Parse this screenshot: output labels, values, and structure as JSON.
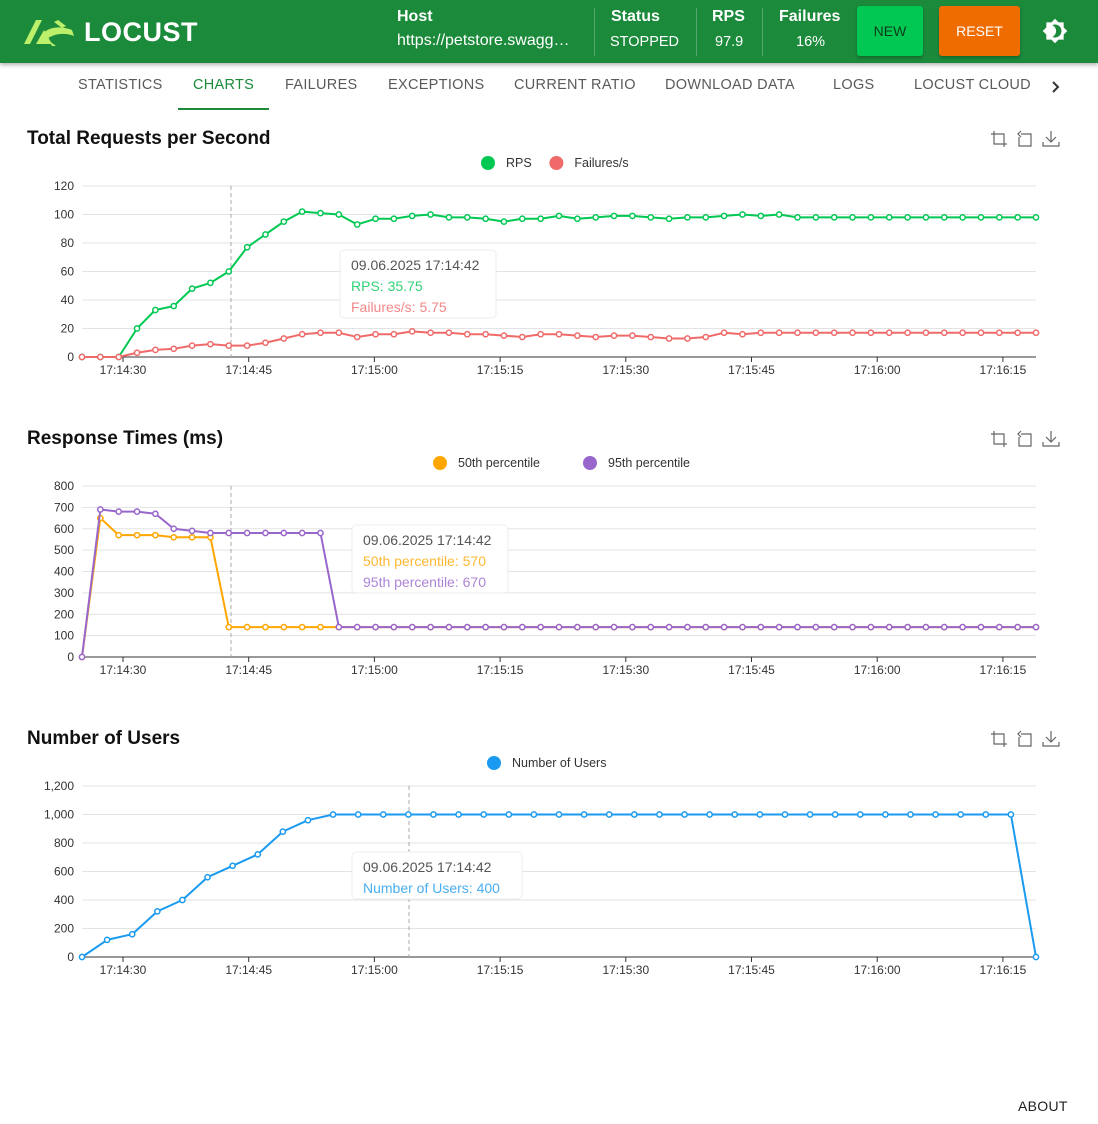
{
  "header": {
    "brand": "LOCUST",
    "host_label": "Host",
    "host_value": "https://petstore.swagg…",
    "status_label": "Status",
    "status_value": "STOPPED",
    "rps_label": "RPS",
    "rps_value": "97.9",
    "failures_label": "Failures",
    "failures_value": "16%",
    "new_label": "NEW",
    "reset_label": "RESET",
    "theme_icon": "brightness-icon"
  },
  "tabs": [
    {
      "label": "STATISTICS",
      "active": false
    },
    {
      "label": "CHARTS",
      "active": true
    },
    {
      "label": "FAILURES",
      "active": false
    },
    {
      "label": "EXCEPTIONS",
      "active": false
    },
    {
      "label": "CURRENT RATIO",
      "active": false
    },
    {
      "label": "DOWNLOAD DATA",
      "active": false
    },
    {
      "label": "LOGS",
      "active": false
    },
    {
      "label": "LOCUST CLOUD",
      "active": false
    }
  ],
  "colors": {
    "brand_green": "#1b8a3b",
    "new_button": "#00c853",
    "reset_button": "#ef6c00",
    "rps": "#00c853",
    "failures": "#f06a6a",
    "p50": "#ffa600",
    "p95": "#9966cc",
    "users": "#1a9af0"
  },
  "footer": {
    "about": "ABOUT"
  },
  "chart_data": [
    {
      "type": "line",
      "title": "Total Requests per Second",
      "x": [
        "17:14:25",
        "17:14:30",
        "17:14:35",
        "17:14:36",
        "17:14:38",
        "17:14:40",
        "17:14:42",
        "17:14:45",
        "17:14:46",
        "17:14:48",
        "17:14:51",
        "17:14:53",
        "17:14:55",
        "17:14:58",
        "17:15:00",
        "17:15:02",
        "17:15:04",
        "17:15:06",
        "17:15:10",
        "17:15:13",
        "17:15:16",
        "17:15:18",
        "17:15:20",
        "17:15:22",
        "17:15:24",
        "17:15:26",
        "17:15:28",
        "17:15:30",
        "17:15:32",
        "17:15:34",
        "17:15:36",
        "17:15:38",
        "17:15:40",
        "17:15:42",
        "17:15:44",
        "17:15:46",
        "17:15:48",
        "17:15:50",
        "17:15:52",
        "17:15:54",
        "17:15:56",
        "17:15:58",
        "17:16:00",
        "17:16:02",
        "17:16:04",
        "17:16:06",
        "17:16:08",
        "17:16:10",
        "17:16:12",
        "17:16:14",
        "17:16:16",
        "17:16:18",
        "17:16:20"
      ],
      "x_ticks": [
        "17:14:30",
        "17:14:45",
        "17:15:00",
        "17:15:15",
        "17:15:30",
        "17:15:45",
        "17:16:00",
        "17:16:15"
      ],
      "series": [
        {
          "name": "RPS",
          "color": "#00c853",
          "values": [
            0,
            0,
            0,
            20,
            33,
            35.75,
            48,
            52,
            60,
            77,
            86,
            95,
            102,
            101,
            100,
            93,
            97,
            97,
            99,
            100,
            98,
            98,
            97,
            95,
            97,
            97,
            99,
            97,
            98,
            99,
            99,
            98,
            97,
            98,
            98,
            99,
            100,
            99,
            100,
            98,
            98,
            98,
            98,
            98,
            98,
            98,
            98,
            98,
            98,
            98,
            98,
            98,
            98
          ]
        },
        {
          "name": "Failures/s",
          "color": "#f06a6a",
          "values": [
            0,
            0,
            0,
            3,
            5,
            5.75,
            8,
            9,
            8,
            8,
            10,
            13,
            16,
            17,
            17,
            14,
            16,
            16,
            18,
            17,
            17,
            16,
            16,
            15,
            14,
            16,
            16,
            15,
            14,
            15,
            15,
            14,
            13,
            13,
            14,
            17,
            16,
            17,
            17,
            17,
            17,
            17,
            17,
            17,
            17,
            17,
            17,
            17,
            17,
            17,
            17,
            17,
            17
          ]
        }
      ],
      "ylim": [
        0,
        120
      ],
      "y_ticks": [
        0,
        20,
        40,
        60,
        80,
        100,
        120
      ],
      "tooltip": {
        "title": "09.06.2025 17:14:42",
        "lines": [
          "RPS: 35.75",
          "Failures/s: 5.75"
        ]
      },
      "legend": "top-center",
      "grid": true
    },
    {
      "type": "line",
      "title": "Response Times (ms)",
      "x_ticks": [
        "17:14:30",
        "17:14:45",
        "17:15:00",
        "17:15:15",
        "17:15:30",
        "17:15:45",
        "17:16:00",
        "17:16:15"
      ],
      "series": [
        {
          "name": "50th percentile",
          "color": "#ffa600",
          "values": [
            0,
            650,
            570,
            570,
            570,
            560,
            560,
            560,
            140,
            140,
            140,
            140,
            140,
            140,
            140,
            140,
            140,
            140,
            140,
            140,
            140,
            140,
            140,
            140,
            140,
            140,
            140,
            140,
            140,
            140,
            140,
            140,
            140,
            140,
            140,
            140,
            140,
            140,
            140,
            140,
            140,
            140,
            140,
            140,
            140,
            140,
            140,
            140,
            140,
            140,
            140,
            140,
            140
          ]
        },
        {
          "name": "95th percentile",
          "color": "#9966cc",
          "values": [
            0,
            690,
            680,
            680,
            670,
            600,
            590,
            580,
            580,
            580,
            580,
            580,
            580,
            580,
            140,
            140,
            140,
            140,
            140,
            140,
            140,
            140,
            140,
            140,
            140,
            140,
            140,
            140,
            140,
            140,
            140,
            140,
            140,
            140,
            140,
            140,
            140,
            140,
            140,
            140,
            140,
            140,
            140,
            140,
            140,
            140,
            140,
            140,
            140,
            140,
            140,
            140,
            140
          ]
        }
      ],
      "ylim": [
        0,
        800
      ],
      "y_ticks": [
        0,
        100,
        200,
        300,
        400,
        500,
        600,
        700,
        800
      ],
      "tooltip": {
        "title": "09.06.2025 17:14:42",
        "lines": [
          "50th percentile: 570",
          "95th percentile: 670"
        ]
      },
      "legend": "top-center",
      "grid": true
    },
    {
      "type": "line",
      "title": "Number of Users",
      "x_ticks": [
        "17:14:30",
        "17:14:45",
        "17:15:00",
        "17:15:15",
        "17:15:30",
        "17:15:45",
        "17:16:00",
        "17:16:15"
      ],
      "series": [
        {
          "name": "Number of Users",
          "color": "#1a9af0",
          "values": [
            0,
            120,
            160,
            320,
            400,
            560,
            640,
            720,
            880,
            960,
            1000,
            1000,
            1000,
            1000,
            1000,
            1000,
            1000,
            1000,
            1000,
            1000,
            1000,
            1000,
            1000,
            1000,
            1000,
            1000,
            1000,
            1000,
            1000,
            1000,
            1000,
            1000,
            1000,
            1000,
            1000,
            1000,
            1000,
            1000,
            0
          ]
        }
      ],
      "ylim": [
        0,
        1200
      ],
      "y_ticks": [
        0,
        200,
        400,
        600,
        800,
        1000,
        1200
      ],
      "y_tick_labels": [
        "0",
        "200",
        "400",
        "600",
        "800",
        "1,000",
        "1,200"
      ],
      "tooltip": {
        "title": "09.06.2025 17:14:42",
        "lines": [
          "Number of Users: 400"
        ]
      },
      "legend": "top-center",
      "grid": true
    }
  ]
}
